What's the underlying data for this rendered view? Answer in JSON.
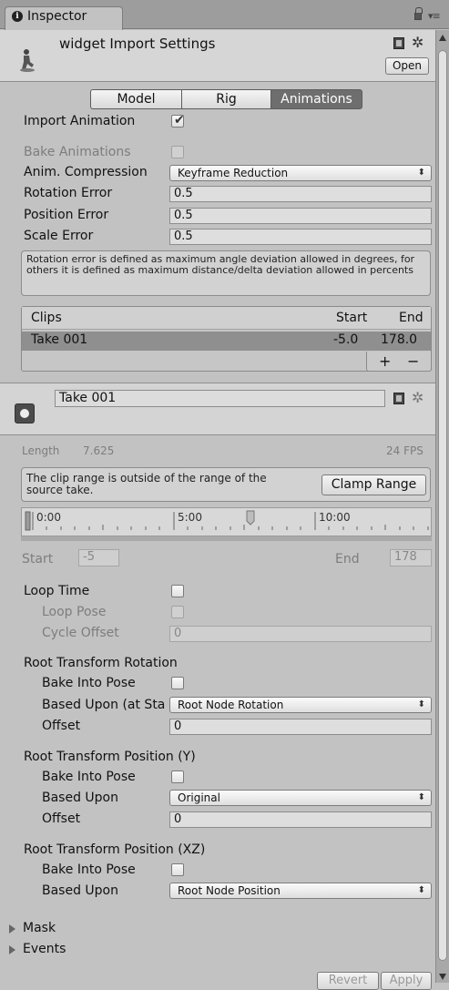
{
  "window": {
    "tab_title": "Inspector"
  },
  "header": {
    "title": "widget Import Settings",
    "open_button": "Open"
  },
  "tabs": {
    "model": "Model",
    "rig": "Rig",
    "animations": "Animations",
    "active": "animations"
  },
  "import": {
    "import_animation_label": "Import Animation",
    "import_animation_checked": true,
    "bake_animations_label": "Bake Animations",
    "bake_animations_checked": false,
    "anim_compression_label": "Anim. Compression",
    "anim_compression_value": "Keyframe Reduction",
    "rotation_error_label": "Rotation Error",
    "rotation_error_value": "0.5",
    "position_error_label": "Position Error",
    "position_error_value": "0.5",
    "scale_error_label": "Scale Error",
    "scale_error_value": "0.5",
    "help_text": "Rotation error is defined as maximum angle deviation allowed in degrees, for others it is defined as maximum distance/delta deviation allowed in percents"
  },
  "clips": {
    "header_clips": "Clips",
    "header_start": "Start",
    "header_end": "End",
    "rows": [
      {
        "name": "Take 001",
        "start": "-5.0",
        "end": "178.0"
      }
    ],
    "add_label": "+",
    "remove_label": "−"
  },
  "clip": {
    "name": "Take 001",
    "length_label": "Length",
    "length_value": "7.625",
    "fps": "24 FPS",
    "warning": "The clip range is outside of the range of the source take.",
    "clamp_button": "Clamp Range",
    "timeline_ticks": [
      "0:00",
      "5:00",
      "10:00"
    ],
    "start_label": "Start",
    "start_value": "-5",
    "end_label": "End",
    "end_value": "178"
  },
  "loop": {
    "loop_time_label": "Loop Time",
    "loop_time_checked": false,
    "loop_pose_label": "Loop Pose",
    "cycle_offset_label": "Cycle Offset",
    "cycle_offset_value": "0"
  },
  "root_rotation": {
    "title": "Root Transform Rotation",
    "bake_label": "Bake Into Pose",
    "based_upon_label": "Based Upon (at Sta",
    "based_upon_value": "Root Node Rotation",
    "offset_label": "Offset",
    "offset_value": "0"
  },
  "root_position_y": {
    "title": "Root Transform Position (Y)",
    "bake_label": "Bake Into Pose",
    "based_upon_label": "Based Upon",
    "based_upon_value": "Original",
    "offset_label": "Offset",
    "offset_value": "0"
  },
  "root_position_xz": {
    "title": "Root Transform Position (XZ)",
    "bake_label": "Bake Into Pose",
    "based_upon_label": "Based Upon",
    "based_upon_value": "Root Node Position"
  },
  "foldouts": {
    "mask": "Mask",
    "events": "Events"
  },
  "footer": {
    "revert": "Revert",
    "apply": "Apply"
  },
  "icons": {
    "info": "info-icon",
    "lock": "lock-icon",
    "menu": "tab-menu-icon",
    "help": "help-book-icon",
    "settings": "gear-icon",
    "play": "play-icon"
  },
  "colors": {
    "background": "#c2c2c2",
    "active_tab": "#6e6e6e",
    "selected_row": "#8f8f8f"
  }
}
